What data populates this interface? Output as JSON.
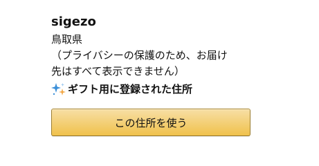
{
  "address": {
    "name": "sigezo",
    "prefecture": "鳥取県",
    "privacy_line1": "（プライバシーの保護のため、お届け",
    "privacy_line2": "先はすべて表示できません）",
    "gift_label": "ギフト用に登録された住所",
    "gift_icon": "sparkle-icon"
  },
  "actions": {
    "use_address_label": "この住所を使う"
  },
  "colors": {
    "button_top": "#f7dfa5",
    "button_bottom": "#f0c14b",
    "button_border": "#a88734",
    "sparkle_blue": "#3b8fd8",
    "sparkle_orange": "#f3a847"
  }
}
